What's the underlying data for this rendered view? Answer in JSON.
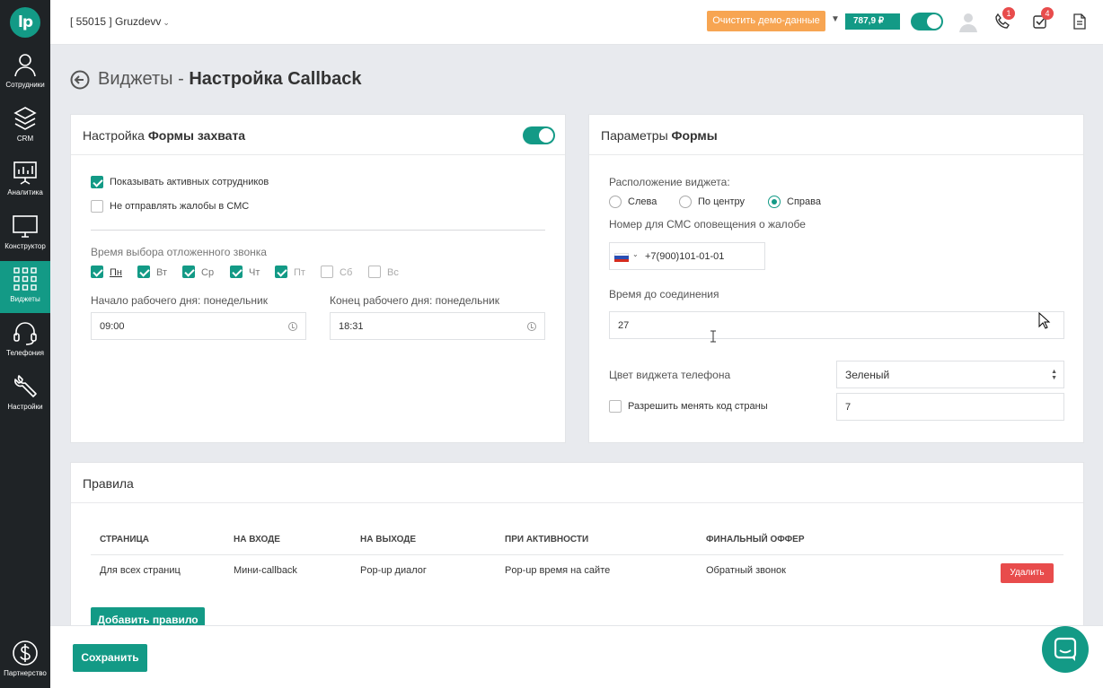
{
  "sidebar": {
    "logo": "lp",
    "items": [
      {
        "label": "Сотрудники",
        "icon": "user-icon"
      },
      {
        "label": "CRM",
        "icon": "layers-icon"
      },
      {
        "label": "Аналитика",
        "icon": "presentation-chart-icon"
      },
      {
        "label": "Конструктор",
        "icon": "monitor-icon"
      },
      {
        "label": "Виджеты",
        "icon": "grid-icon",
        "active": true
      },
      {
        "label": "Телефония",
        "icon": "headset-icon"
      },
      {
        "label": "Настройки",
        "icon": "wrench-icon"
      }
    ],
    "bottom_item": {
      "label": "Партнерство",
      "icon": "dollar-icon"
    }
  },
  "topbar": {
    "account": "[ 55015 ] Gruzdevv",
    "demo_button": "Очистить демо-данные",
    "balance": "787,9 ₽",
    "phone_badge": "1",
    "tasks_badge": "4"
  },
  "page": {
    "title_prefix": "Виджеты - ",
    "title_main": "Настройка Callback"
  },
  "capture_form": {
    "title_plain": "Настройка ",
    "title_bold": "Формы захвата",
    "enabled": true,
    "show_active_staff": "Показывать активных сотрудников",
    "no_sms_complaints": "Не отправлять жалобы в СМС",
    "delayed_call_label": "Время выбора отложенного звонка",
    "days": [
      {
        "label": "Пн",
        "checked": true
      },
      {
        "label": "Вт",
        "checked": true
      },
      {
        "label": "Ср",
        "checked": true
      },
      {
        "label": "Чт",
        "checked": true
      },
      {
        "label": "Пт",
        "checked": true
      },
      {
        "label": "Сб",
        "checked": false
      },
      {
        "label": "Вс",
        "checked": false
      }
    ],
    "workday_start_label": "Начало рабочего дня: понедельник",
    "workday_start": "09:00",
    "workday_end_label": "Конец рабочего дня: понедельник",
    "workday_end": "18:31"
  },
  "form_params": {
    "title_plain": "Параметры ",
    "title_bold": "Формы",
    "position_label": "Расположение виджета:",
    "position_options": [
      "Слева",
      "По центру",
      "Справа"
    ],
    "position_selected": "Справа",
    "sms_number_label": "Номер для СМС оповещения о жалобе",
    "sms_number": "+7(900)101-01-01",
    "connect_time_label": "Время до соединения",
    "connect_time": "27",
    "phone_color_label": "Цвет виджета телефона",
    "phone_color": "Зеленый",
    "allow_country_code": "Разрешить менять код страны",
    "country_code_value": "7"
  },
  "rules": {
    "title": "Правила",
    "columns": [
      "СТРАНИЦА",
      "НА ВХОДЕ",
      "НА ВЫХОДЕ",
      "ПРИ АКТИВНОСТИ",
      "ФИНАЛЬНЫЙ ОФФЕР"
    ],
    "rows": [
      {
        "page": "Для всех страниц",
        "on_enter": "Мини-callback",
        "on_exit": "Pop-up диалог",
        "on_activity": "Pop-up время на сайте",
        "final_offer": "Обратный звонок",
        "delete": "Удалить"
      }
    ],
    "add_button": "Добавить правило"
  },
  "footer": {
    "save_button": "Сохранить"
  },
  "colors": {
    "accent": "#139a86",
    "sidebar": "#1f2326",
    "danger": "#e84c4c",
    "warning": "#f7a552"
  }
}
